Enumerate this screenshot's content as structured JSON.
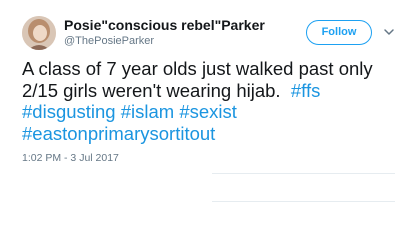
{
  "author": {
    "display_name": "Posie\"conscious rebel\"Parker",
    "handle": "@ThePosieParker"
  },
  "follow_button": {
    "label": "Follow"
  },
  "tweet": {
    "line1": "A class of 7 year olds just walked past only",
    "line2_text": "2/15 girls weren't wearing hijab.",
    "hashtags": [
      "#ffs",
      "#disgusting",
      "#islam",
      "#sexist",
      "#eastonprimarysortitout"
    ],
    "timestamp": "1:02 PM - 3 Jul 2017"
  },
  "colors": {
    "accent": "#1da1f2",
    "hashtag": "#1b95e0",
    "text": "#14171a",
    "secondary": "#657786"
  },
  "icons": {
    "avatar": "profile-photo",
    "menu": "chevron-down-icon"
  }
}
